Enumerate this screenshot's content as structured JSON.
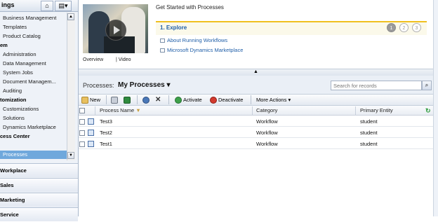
{
  "nav": {
    "title": "ings",
    "icons": [
      "home-icon",
      "folder-dropdown-icon"
    ],
    "items": [
      {
        "type": "item",
        "label": "Business Management"
      },
      {
        "type": "item",
        "label": "Templates"
      },
      {
        "type": "item",
        "label": "Product Catalog"
      },
      {
        "type": "section",
        "label": "em"
      },
      {
        "type": "item",
        "label": "Administration"
      },
      {
        "type": "item",
        "label": "Data Management"
      },
      {
        "type": "item",
        "label": "System Jobs"
      },
      {
        "type": "item",
        "label": "Document Managem..."
      },
      {
        "type": "item",
        "label": "Auditing"
      },
      {
        "type": "section",
        "label": "tomization"
      },
      {
        "type": "item",
        "label": "Customizations"
      },
      {
        "type": "item",
        "label": "Solutions"
      },
      {
        "type": "item",
        "label": "Dynamics Marketplace"
      },
      {
        "type": "section",
        "label": "cess Center"
      },
      {
        "type": "item",
        "label": "Processes",
        "selected": true
      }
    ],
    "areas": [
      "Workplace",
      "Sales",
      "Marketing",
      "Service"
    ]
  },
  "get_started": {
    "title": "Get Started with Processes",
    "video_labels": [
      "Overview",
      "| Video"
    ],
    "step_label": "1. Explore",
    "steps": [
      "1",
      "2",
      "3"
    ],
    "links": [
      "About Running Workflows",
      "Microsoft Dynamics Marketplace"
    ],
    "collapse_glyph": "▲"
  },
  "view": {
    "prefix": "Processes:",
    "name": "My Processes",
    "search_placeholder": "Search for records"
  },
  "toolbar": {
    "new_label": "New",
    "activate_label": "Activate",
    "deactivate_label": "Deactivate",
    "more_actions_label": "More Actions"
  },
  "grid": {
    "columns": [
      "Process Name",
      "Category",
      "Primary Entity"
    ],
    "rows": [
      {
        "name": "Test3",
        "category": "Workflow",
        "entity": "student"
      },
      {
        "name": "Test2",
        "category": "Workflow",
        "entity": "student"
      },
      {
        "name": "Test1",
        "category": "Workflow",
        "entity": "student"
      }
    ]
  },
  "colors": {
    "accent": "#1f5ea8",
    "selected": "#6fa8dc",
    "step_bar": "#f0c020"
  }
}
